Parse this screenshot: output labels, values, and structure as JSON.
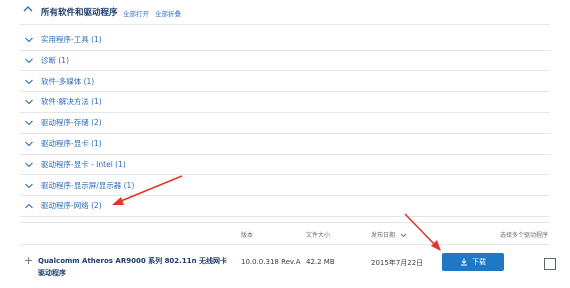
{
  "header": {
    "title": "所有软件和驱动程序",
    "expand_all": "全部打开",
    "collapse_all": "全部折叠"
  },
  "categories": [
    {
      "label": "实用程序-工具 (1)",
      "expanded": false
    },
    {
      "label": "诊断 (1)",
      "expanded": false
    },
    {
      "label": "软件-多媒体 (1)",
      "expanded": false
    },
    {
      "label": "软件-解决方法 (1)",
      "expanded": false
    },
    {
      "label": "驱动程序-存储 (2)",
      "expanded": false
    },
    {
      "label": "驱动程序-显卡 (1)",
      "expanded": false
    },
    {
      "label": "驱动程序-显卡 - Intel (1)",
      "expanded": false
    },
    {
      "label": "驱动程序-显示屏/显示器 (1)",
      "expanded": false
    },
    {
      "label": "驱动程序-网络 (2)",
      "expanded": true
    }
  ],
  "table": {
    "headers": {
      "version": "版本",
      "size": "文件大小",
      "release_date": "发布日期",
      "select_multiple": "选择多个驱动程序"
    },
    "row": {
      "name": "Qualcomm Atheros AR9000 系列 802.11n 无线网卡驱动程序",
      "version": "10.0.0.318 Rev.A",
      "size": "42.2 MB",
      "date": "2015年7月22日",
      "download_label": "下载",
      "selected": false
    }
  },
  "colors": {
    "accent": "#1e78c8",
    "link": "#2a6cb8",
    "annotation_arrow": "#e5352b"
  },
  "icons": {
    "header_toggle": "chevron-up-icon",
    "category_toggle": "chevron-down-icon",
    "download": "download-icon",
    "expand_row": "plus-icon"
  }
}
